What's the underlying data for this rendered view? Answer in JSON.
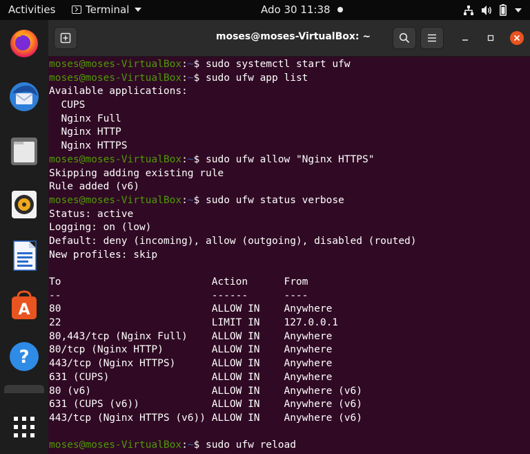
{
  "topbar": {
    "activities": "Activities",
    "app_menu": "Terminal",
    "clock": "Ado 30  11:38"
  },
  "dock": {
    "items": [
      "firefox-icon",
      "thunderbird-icon",
      "files-icon",
      "rhythmbox-icon",
      "libreoffice-writer-icon",
      "ubuntu-software-icon",
      "help-icon",
      "show-applications-icon"
    ]
  },
  "window": {
    "title": "moses@moses-VirtualBox: ~"
  },
  "terminal": {
    "prompt_user": "moses@moses-VirtualBox",
    "prompt_sep": ":",
    "prompt_path": "~",
    "prompt_end": "$ ",
    "lines": [
      {
        "type": "cmd",
        "text": "sudo systemctl start ufw"
      },
      {
        "type": "cmd",
        "text": "sudo ufw app list"
      },
      {
        "type": "out",
        "text": "Available applications:"
      },
      {
        "type": "out",
        "text": "  CUPS"
      },
      {
        "type": "out",
        "text": "  Nginx Full"
      },
      {
        "type": "out",
        "text": "  Nginx HTTP"
      },
      {
        "type": "out",
        "text": "  Nginx HTTPS"
      },
      {
        "type": "cmd",
        "text": "sudo ufw allow \"Nginx HTTPS\""
      },
      {
        "type": "out",
        "text": "Skipping adding existing rule"
      },
      {
        "type": "out",
        "text": "Rule added (v6)"
      },
      {
        "type": "cmd",
        "text": "sudo ufw status verbose"
      },
      {
        "type": "out",
        "text": "Status: active"
      },
      {
        "type": "out",
        "text": "Logging: on (low)"
      },
      {
        "type": "out",
        "text": "Default: deny (incoming), allow (outgoing), disabled (routed)"
      },
      {
        "type": "out",
        "text": "New profiles: skip"
      },
      {
        "type": "out",
        "text": ""
      },
      {
        "type": "out",
        "text": "To                         Action      From"
      },
      {
        "type": "out",
        "text": "--                         ------      ----"
      },
      {
        "type": "out",
        "text": "80                         ALLOW IN    Anywhere"
      },
      {
        "type": "out",
        "text": "22                         LIMIT IN    127.0.0.1"
      },
      {
        "type": "out",
        "text": "80,443/tcp (Nginx Full)    ALLOW IN    Anywhere"
      },
      {
        "type": "out",
        "text": "80/tcp (Nginx HTTP)        ALLOW IN    Anywhere"
      },
      {
        "type": "out",
        "text": "443/tcp (Nginx HTTPS)      ALLOW IN    Anywhere"
      },
      {
        "type": "out",
        "text": "631 (CUPS)                 ALLOW IN    Anywhere"
      },
      {
        "type": "out",
        "text": "80 (v6)                    ALLOW IN    Anywhere (v6)"
      },
      {
        "type": "out",
        "text": "631 (CUPS (v6))            ALLOW IN    Anywhere (v6)"
      },
      {
        "type": "out",
        "text": "443/tcp (Nginx HTTPS (v6)) ALLOW IN    Anywhere (v6)"
      },
      {
        "type": "out",
        "text": ""
      },
      {
        "type": "cmd",
        "text": "sudo ufw reload"
      }
    ]
  },
  "colors": {
    "terminal_bg": "#300a24",
    "prompt_user": "#4e9a06",
    "prompt_path": "#3465a4",
    "accent": "#e95420"
  }
}
